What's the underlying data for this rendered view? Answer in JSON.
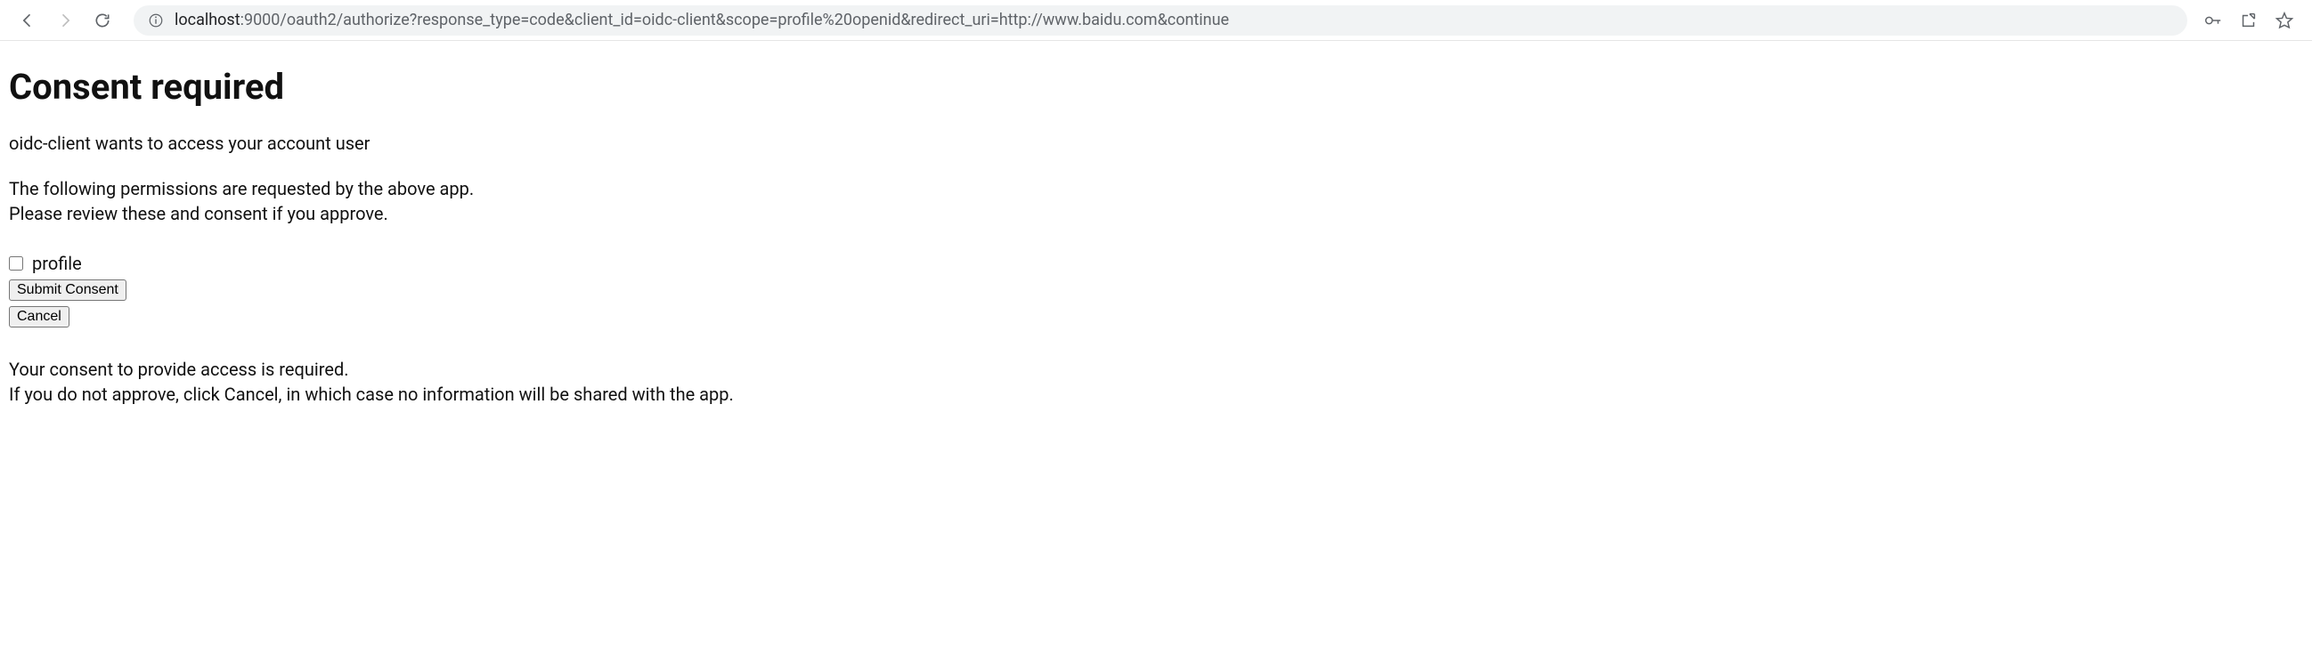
{
  "browser": {
    "url_host": "localhost",
    "url_rest": ":9000/oauth2/authorize?response_type=code&client_id=oidc-client&scope=profile%20openid&redirect_uri=http://www.baidu.com&continue"
  },
  "page": {
    "heading": "Consent required",
    "access_line": "oidc-client wants to access your account user",
    "perm_line1": "The following permissions are requested by the above app.",
    "perm_line2": "Please review these and consent if you approve.",
    "scope_label": "profile",
    "submit_label": "Submit Consent",
    "cancel_label": "Cancel",
    "footer_line1": "Your consent to provide access is required.",
    "footer_line2": "If you do not approve, click Cancel, in which case no information will be shared with the app."
  }
}
